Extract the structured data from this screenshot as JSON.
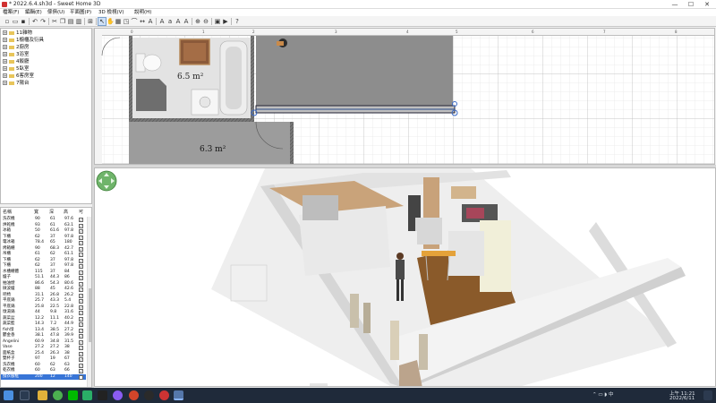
{
  "window": {
    "title": "* 2022.6.4.sh3d - Sweet Home 3D",
    "controls": [
      "—",
      "☐",
      "✕"
    ]
  },
  "menu": [
    "檔案(F)",
    "編輯(E)",
    "傢俱(U)",
    "平面圖(P)",
    "3D 檢視(V)",
    "說明(H)"
  ],
  "catalog": [
    {
      "label": "11雜物",
      "expanded": false
    },
    {
      "label": "1櫥櫃及衍具",
      "expanded": false
    },
    {
      "label": "2廚房",
      "expanded": false
    },
    {
      "label": "3浴室",
      "expanded": false
    },
    {
      "label": "4飯廳",
      "expanded": false
    },
    {
      "label": "5臥室",
      "expanded": false
    },
    {
      "label": "6客房室",
      "expanded": false
    },
    {
      "label": "7陽台",
      "expanded": false
    }
  ],
  "plan": {
    "room1_area": "6.5 m²",
    "room2_area": "6.3 m²",
    "ruler_labels": [
      "0",
      "1",
      "2",
      "3",
      "4",
      "5",
      "6",
      "7",
      "8",
      "9"
    ]
  },
  "furniture_table": {
    "headers": [
      "名稱",
      "寬",
      "深",
      "高",
      "可"
    ],
    "rows": [
      {
        "name": "洗衣機",
        "w": "90",
        "d": "61",
        "h": "97.6",
        "v": true
      },
      {
        "name": "烘乾機",
        "w": "93",
        "d": "61",
        "h": "63.1",
        "v": true
      },
      {
        "name": "冰箱",
        "w": "50",
        "d": "61.6",
        "h": "97.8",
        "v": true
      },
      {
        "name": "下櫃",
        "w": "62",
        "d": "37",
        "h": "97.8",
        "v": true
      },
      {
        "name": "電冰箱",
        "w": "78.4",
        "d": "65",
        "h": "180",
        "v": true
      },
      {
        "name": "烤箱櫃",
        "w": "90",
        "d": "68.3",
        "h": "42.7",
        "v": true
      },
      {
        "name": "吊櫃",
        "w": "61",
        "d": "62",
        "h": "61.1",
        "v": true
      },
      {
        "name": "下櫃",
        "w": "62",
        "d": "37",
        "h": "97.8",
        "v": true
      },
      {
        "name": "下櫃",
        "w": "62",
        "d": "37",
        "h": "97.8",
        "v": true
      },
      {
        "name": "水槽櫃體",
        "w": "115",
        "d": "37",
        "h": "84",
        "v": true
      },
      {
        "name": "爐子",
        "w": "51.1",
        "d": "44.3",
        "h": "86",
        "v": true
      },
      {
        "name": "抽油煙",
        "w": "86.6",
        "d": "54.3",
        "h": "80.6",
        "v": true
      },
      {
        "name": "微波爐",
        "w": "88",
        "d": "45",
        "h": "42.6",
        "v": true
      },
      {
        "name": "吧椅",
        "w": "31.1",
        "d": "26.8",
        "h": "26.2",
        "v": true
      },
      {
        "name": "平底鍋",
        "w": "25.7",
        "d": "43.3",
        "h": "5.4",
        "v": true
      },
      {
        "name": "平底鍋",
        "w": "25.8",
        "d": "22.5",
        "h": "22.8",
        "v": true
      },
      {
        "name": "燉湯鍋",
        "w": "44",
        "d": "9.8",
        "h": "31.6",
        "v": true
      },
      {
        "name": "蔬菜盆",
        "w": "12.2",
        "d": "11.1",
        "h": "40.2",
        "v": true
      },
      {
        "name": "蔬菜籃",
        "w": "14.3",
        "d": "7.2",
        "h": "44.9",
        "v": true
      },
      {
        "name": "fish燈",
        "w": "13.4",
        "d": "38.5",
        "h": "27.2",
        "v": true
      },
      {
        "name": "鬱金香",
        "w": "38.1",
        "d": "47.8",
        "h": "39.9",
        "v": true
      },
      {
        "name": "Angelini",
        "w": "60.9",
        "d": "34.8",
        "h": "31.5",
        "v": true
      },
      {
        "name": "Vase",
        "w": "27.2",
        "d": "27.2",
        "h": "38",
        "v": true
      },
      {
        "name": "面紙盒",
        "w": "25.4",
        "d": "26.3",
        "h": "38",
        "v": true
      },
      {
        "name": "雙杯子",
        "w": "97",
        "d": "19",
        "h": "67",
        "v": true
      },
      {
        "name": "洗衣機",
        "w": "60",
        "d": "62",
        "h": "63",
        "v": true
      },
      {
        "name": "乾衣機",
        "w": "60",
        "d": "63",
        "h": "66",
        "v": true
      },
      {
        "name": "換衣服框",
        "w": "200",
        "d": "12",
        "h": "140",
        "v": true
      }
    ]
  },
  "taskbar": {
    "time": "上午 11:21",
    "date": "2022/6/11"
  }
}
